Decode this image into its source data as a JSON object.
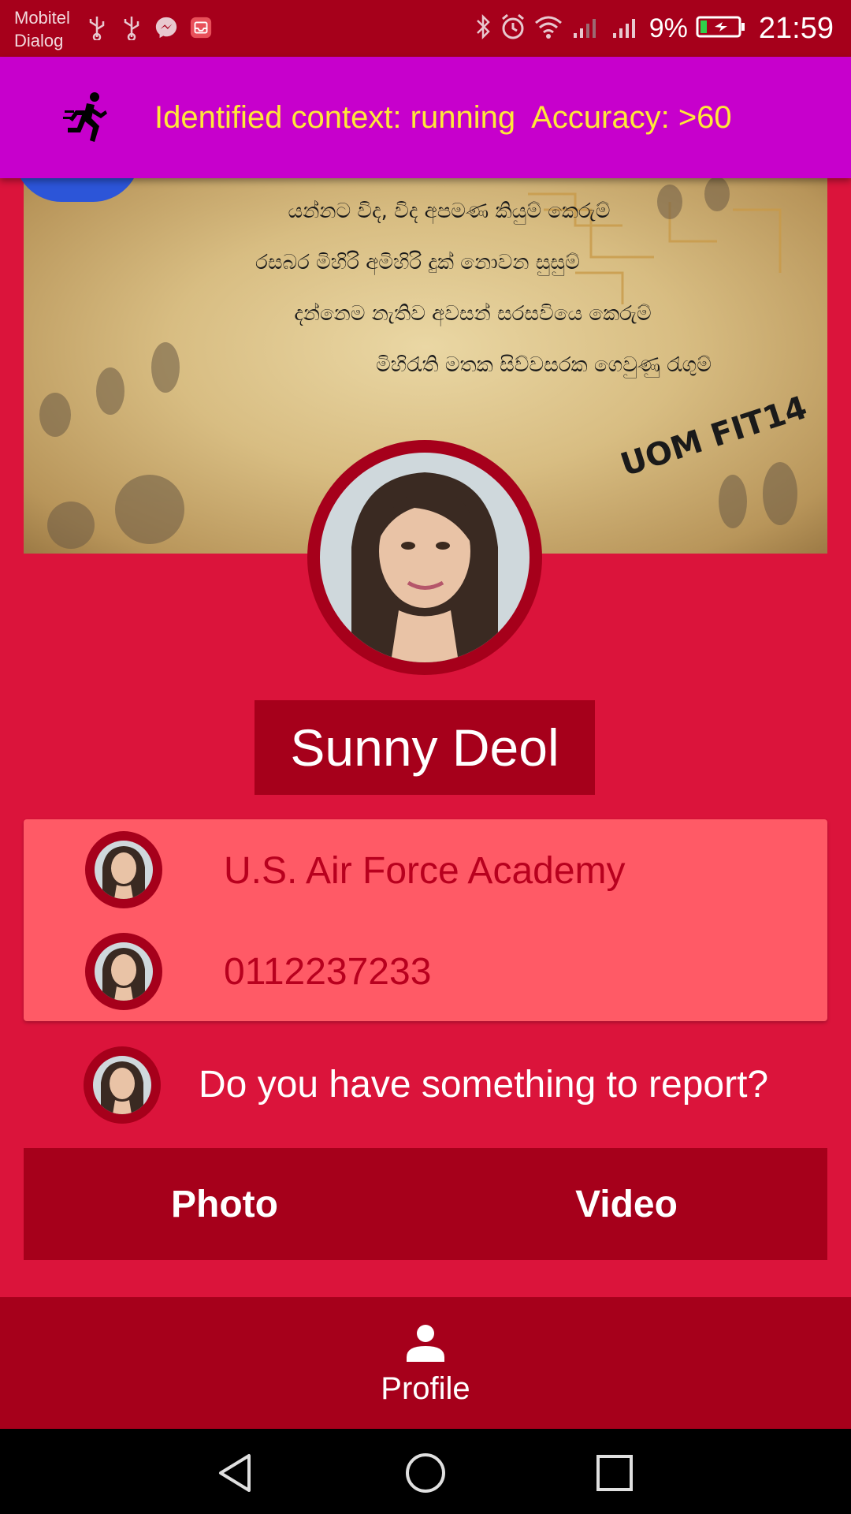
{
  "status_bar": {
    "carrier_line1": "Mobitel",
    "carrier_line2": "Dialog",
    "battery_percent": "9%",
    "time": "21:59",
    "left_icons": [
      "usb-icon",
      "usb-icon",
      "messenger-icon",
      "inbox-icon"
    ],
    "right_icons": [
      "bluetooth-icon",
      "alarm-icon",
      "wifi-icon",
      "signal-icon",
      "signal-icon",
      "battery-charging-icon"
    ]
  },
  "context_banner": {
    "icon": "running-person-icon",
    "text": "Identified context: running  Accuracy: >60",
    "background": "#c700cc",
    "text_color": "#ffe838"
  },
  "cover": {
    "lines": [
      "යන්නට විද, විද අපමණ කියුම් කෙරුම්",
      "රසබර මිහිරි අමිහිරි දුක් නොවන සුසුම්",
      "දන්නෙම නැතිව අවසන් සරසවියෙ කෙරුම්",
      "මිහිරැති මතක සිව්වසරක ගෙවුණු රැගුම්"
    ],
    "badge": "UOM FIT14"
  },
  "profile": {
    "name": "Sunny Deol",
    "institution": "U.S. Air Force Academy",
    "phone": "0112237233"
  },
  "report": {
    "prompt": "Do you have something to report?",
    "photo_label": "Photo",
    "video_label": "Video"
  },
  "bottom_nav": {
    "items": [
      {
        "label": "Profile",
        "icon": "person-icon"
      }
    ]
  },
  "system_nav": [
    "back-icon",
    "home-icon",
    "recents-icon"
  ],
  "colors": {
    "primary_dark": "#a6001b",
    "primary": "#db143b",
    "card": "#ff5a66"
  }
}
